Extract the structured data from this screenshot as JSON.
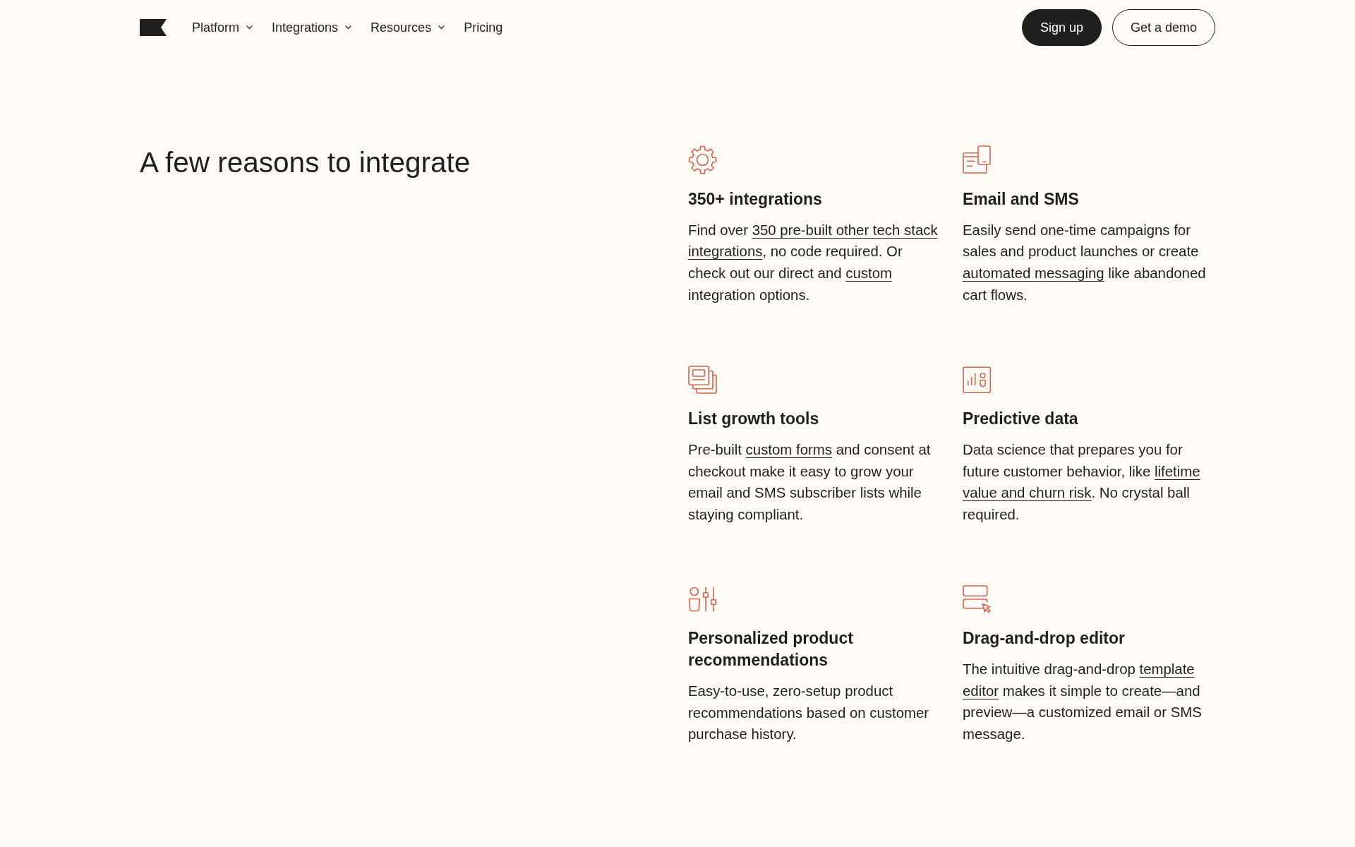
{
  "nav": {
    "items": [
      {
        "label": "Platform",
        "dropdown": true
      },
      {
        "label": "Integrations",
        "dropdown": true
      },
      {
        "label": "Resources",
        "dropdown": true
      },
      {
        "label": "Pricing",
        "dropdown": false
      }
    ],
    "buttons": [
      {
        "label": "Sign up",
        "kind": "primary"
      },
      {
        "label": "Get a demo",
        "kind": "outline"
      }
    ]
  },
  "section": {
    "heading": "A few reasons to integrate",
    "features": [
      {
        "title": "350+ integrations",
        "body": [
          {
            "text": "Find over ",
            "link": false
          },
          {
            "text": "350 pre-built other tech stack ",
            "link": true
          },
          {
            "text": "integrations",
            "link": true
          },
          {
            "text": ", no code required. Or check out our direct and ",
            "link": false
          },
          {
            "text": "custom",
            "link": true
          },
          {
            "text": " integration options.",
            "link": false
          }
        ]
      },
      {
        "title": "Email and SMS",
        "body": [
          {
            "text": "Easily send one-time campaigns for sales and product launches or create ",
            "link": false
          },
          {
            "text": "automated messaging",
            "link": true
          },
          {
            "text": " like abandoned cart flows.",
            "link": false
          }
        ]
      },
      {
        "title": "List growth tools",
        "body": [
          {
            "text": "Pre-built ",
            "link": false
          },
          {
            "text": "custom forms",
            "link": true
          },
          {
            "text": " and consent at checkout make it easy to grow your email and SMS subscriber lists while staying compliant.",
            "link": false
          }
        ]
      },
      {
        "title": "Predictive data",
        "body": [
          {
            "text": "Data science that prepares you for future customer behavior, like ",
            "link": false
          },
          {
            "text": "lifetime ",
            "link": true
          },
          {
            "text": "value and churn risk",
            "link": true
          },
          {
            "text": ". No crystal ball required.",
            "link": false
          }
        ]
      },
      {
        "title": "Personalized product recommendations",
        "body": [
          {
            "text": "Easy-to-use, zero-setup product recommendations based on customer purchase history.",
            "link": false
          }
        ]
      },
      {
        "title": "Drag-and-drop editor",
        "body": [
          {
            "text": "The intuitive drag-and-drop ",
            "link": false
          },
          {
            "text": "template ",
            "link": true
          },
          {
            "text": "editor",
            "link": true
          },
          {
            "text": " makes it simple to create—and preview—a customized email or SMS message.",
            "link": false
          }
        ]
      }
    ]
  }
}
